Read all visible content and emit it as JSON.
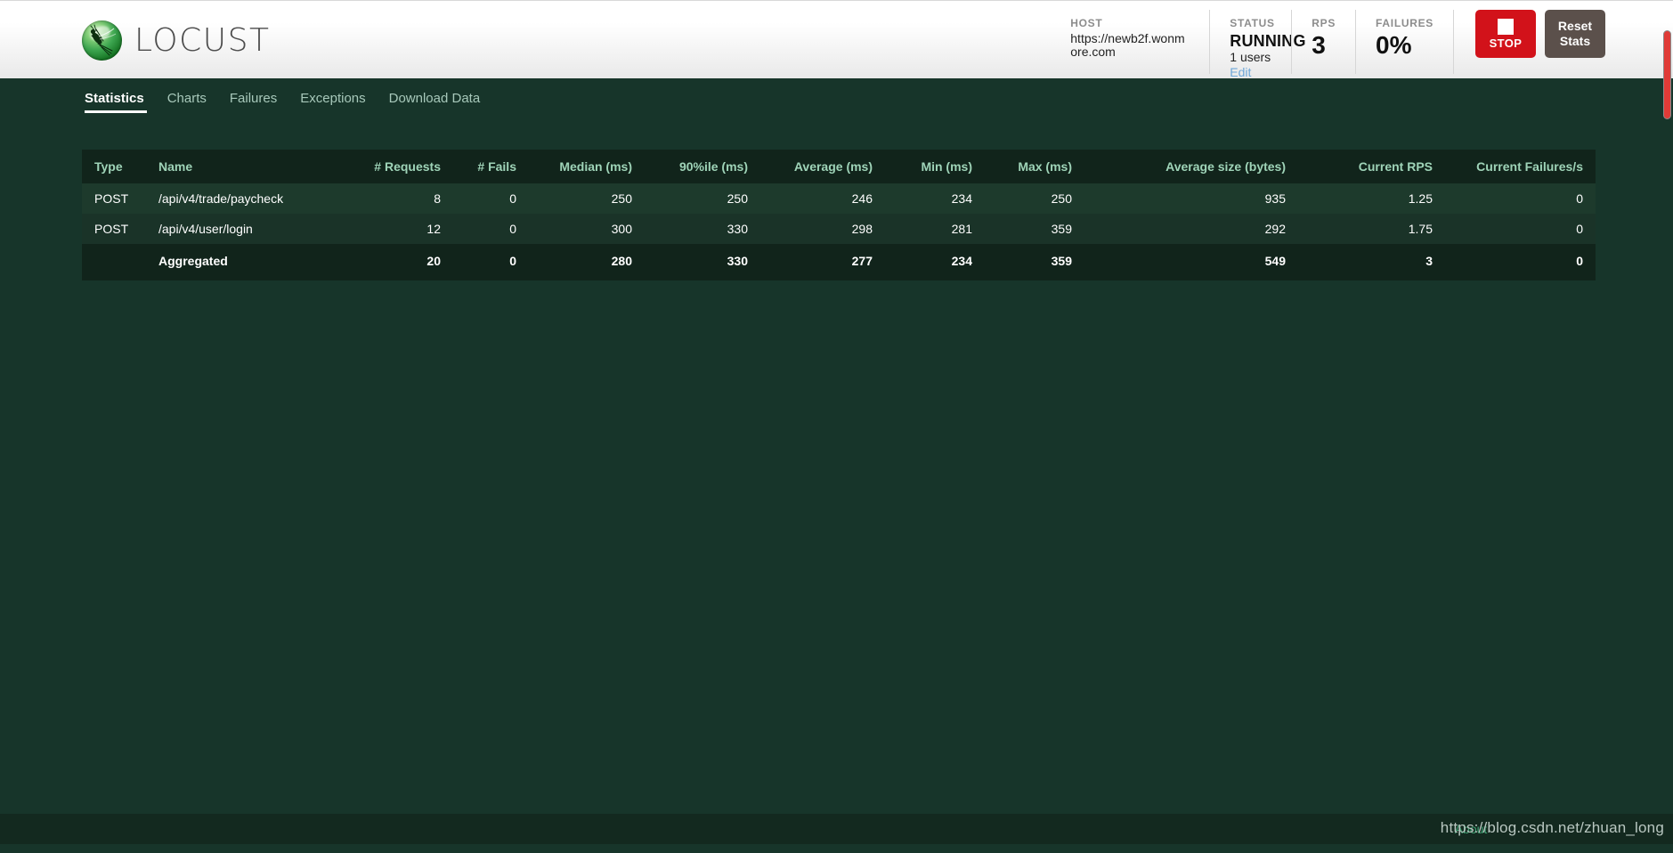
{
  "brand": {
    "name": "LOCUST",
    "logo_icon": "locust-bug-icon"
  },
  "header": {
    "host": {
      "label": "HOST",
      "value": "https://newb2f.wonmore.com"
    },
    "status": {
      "label": "STATUS",
      "value": "RUNNING",
      "users": "1 users",
      "edit_label": "Edit"
    },
    "rps": {
      "label": "RPS",
      "value": "3"
    },
    "failures": {
      "label": "FAILURES",
      "value": "0%"
    },
    "stop_button": {
      "label": "STOP",
      "icon": "stop-square-icon",
      "color": "#d2121a"
    },
    "reset_button": {
      "label": "Reset Stats",
      "line1": "Reset",
      "line2": "Stats",
      "color": "#5b504b"
    }
  },
  "nav": {
    "tabs": [
      {
        "label": "Statistics",
        "active": true
      },
      {
        "label": "Charts",
        "active": false
      },
      {
        "label": "Failures",
        "active": false
      },
      {
        "label": "Exceptions",
        "active": false
      },
      {
        "label": "Download Data",
        "active": false
      }
    ]
  },
  "table": {
    "columns": [
      "Type",
      "Name",
      "# Requests",
      "# Fails",
      "Median (ms)",
      "90%ile (ms)",
      "Average (ms)",
      "Min (ms)",
      "Max (ms)",
      "Average size (bytes)",
      "Current RPS",
      "Current Failures/s"
    ],
    "rows": [
      {
        "type": "POST",
        "name": "/api/v4/trade/paycheck",
        "requests": "8",
        "fails": "0",
        "median": "250",
        "p90": "250",
        "average": "246",
        "min": "234",
        "max": "250",
        "avg_size": "935",
        "current_rps": "1.25",
        "current_failures": "0"
      },
      {
        "type": "POST",
        "name": "/api/v4/user/login",
        "requests": "12",
        "fails": "0",
        "median": "300",
        "p90": "330",
        "average": "298",
        "min": "281",
        "max": "359",
        "avg_size": "292",
        "current_rps": "1.75",
        "current_failures": "0"
      }
    ],
    "total": {
      "type": "",
      "name": "Aggregated",
      "requests": "20",
      "fails": "0",
      "median": "280",
      "p90": "330",
      "average": "277",
      "min": "234",
      "max": "359",
      "avg_size": "549",
      "current_rps": "3",
      "current_failures": "0"
    }
  },
  "footer": {
    "about_label": "About"
  },
  "watermark": {
    "text": "https://blog.csdn.net/zhuan_long"
  },
  "colors": {
    "page_bg": "#17352a",
    "table_header_bg": "#11241b",
    "accent_link": "#6ea7d8",
    "stop_red": "#d2121a",
    "scrollbar_thumb": "#e03b37"
  }
}
